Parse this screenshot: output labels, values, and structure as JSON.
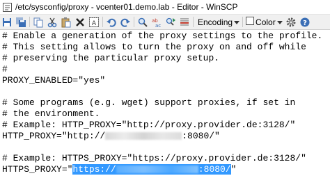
{
  "window": {
    "title": "/etc/sysconfig/proxy - vcenter01.demo.lab - Editor - WinSCP",
    "app_icon": "winscp-icon"
  },
  "toolbar": {
    "buttons": [
      "save-icon",
      "save-all-icon",
      "copy-icon",
      "cut-icon",
      "paste-icon",
      "delete-icon",
      "select-all-icon",
      "undo-icon",
      "redo-icon",
      "find-icon",
      "replace-icon",
      "find-next-icon",
      "go-to-line-icon"
    ],
    "encoding_label": "Encoding",
    "color_label": "Color",
    "preferences_icon": "gear-icon",
    "help_icon": "help-icon"
  },
  "editor": {
    "lines": [
      "# Enable a generation of the proxy settings to the profile.",
      "# This setting allows to turn the proxy on and off while",
      "# preserving the particular proxy setup.",
      "#",
      "PROXY_ENABLED=\"yes\"",
      "",
      "# Some programs (e.g. wget) support proxies, if set in",
      "# the environment.",
      "# Example: HTTP_PROXY=\"http://proxy.provider.de:3128/\"",
      "",
      "",
      "# Example: HTTPS_PROXY=\"https://proxy.provider.de:3128/\"",
      ""
    ],
    "http_line": {
      "prefix": "HTTP_PROXY=\"http://",
      "suffix": ":8080/\""
    },
    "https_line": {
      "prefix": "HTTPS_PROXY=\"",
      "selected_prefix": "https://",
      "selected_suffix": ":8080/",
      "suffix": "\""
    },
    "selection_color": "#3399ff"
  }
}
